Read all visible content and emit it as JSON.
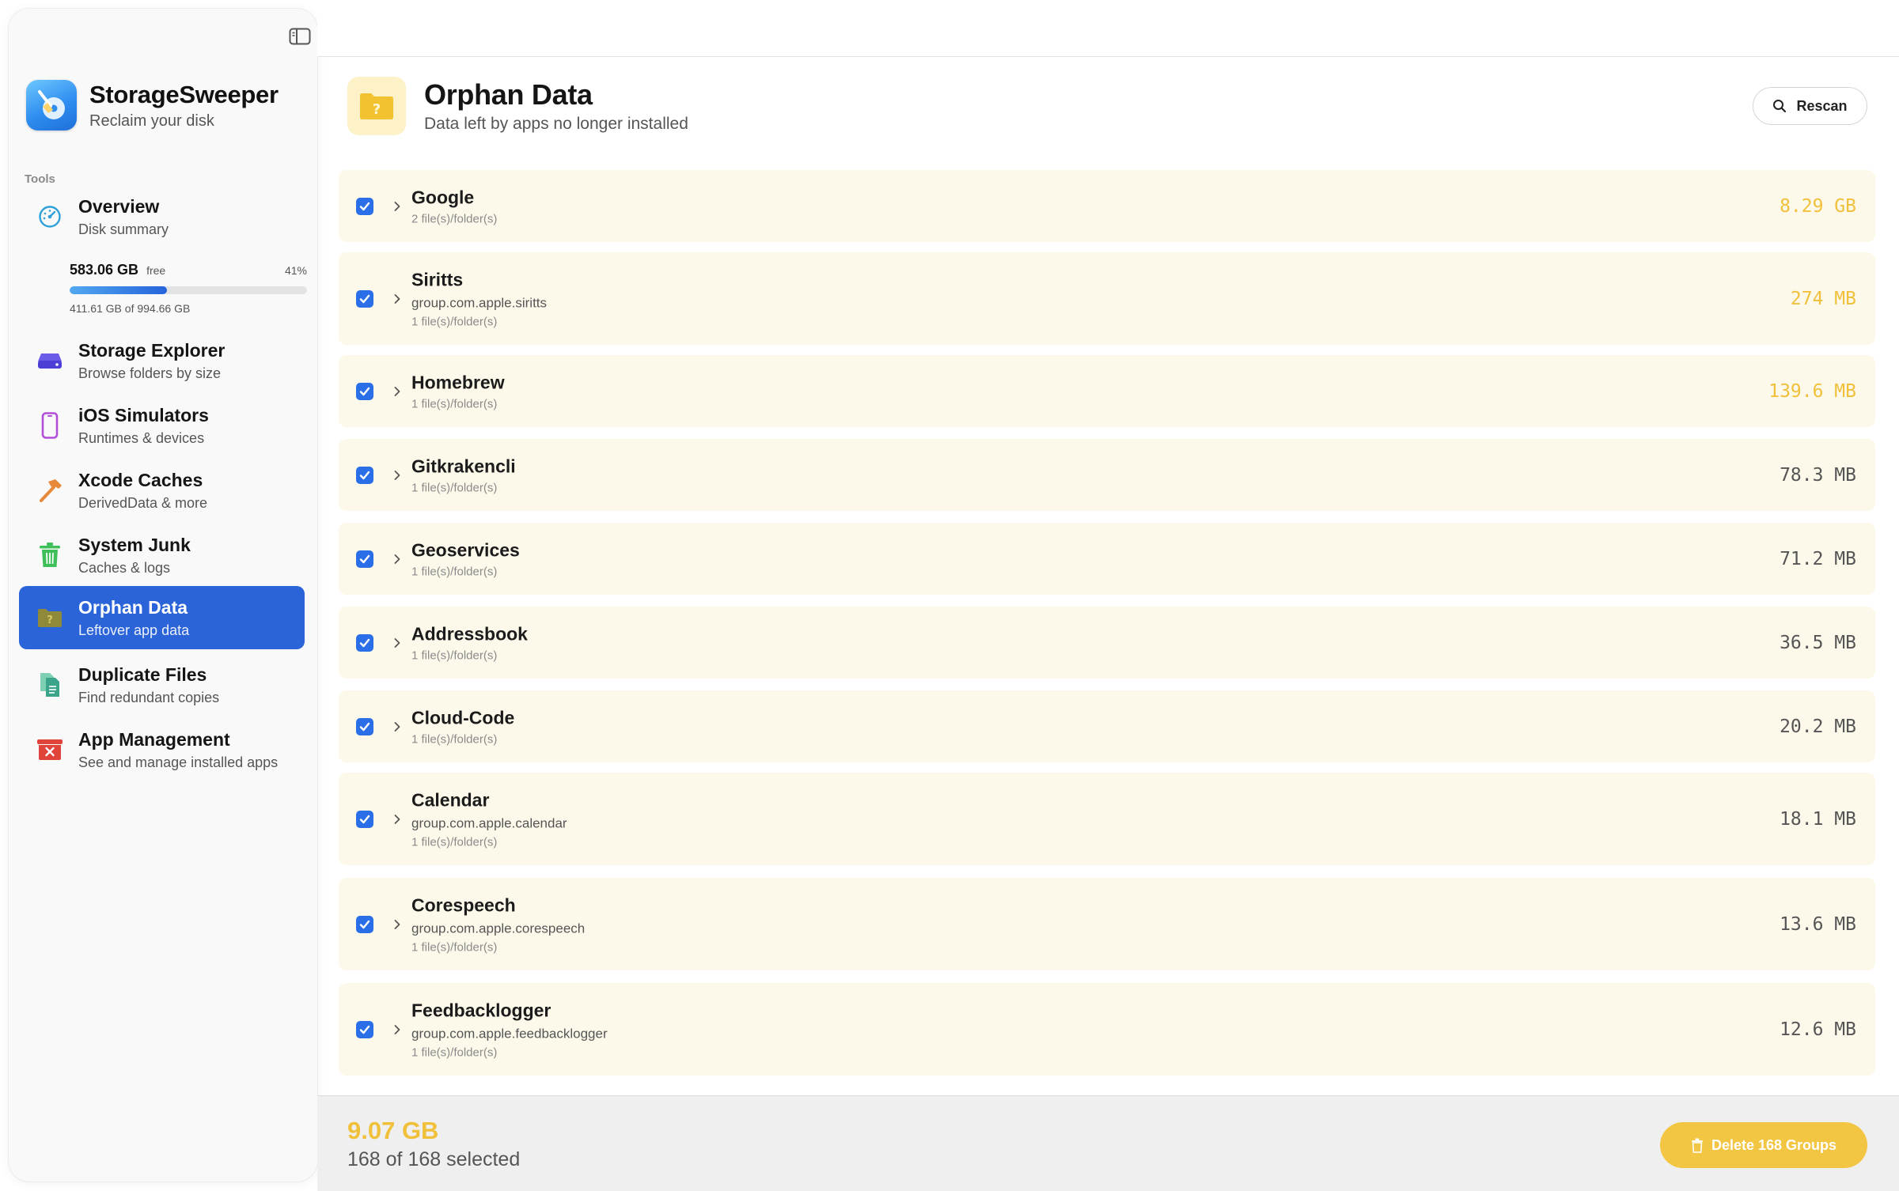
{
  "sidebar": {
    "app_title": "StorageSweeper",
    "app_subtitle": "Reclaim your disk",
    "section_label": "Tools",
    "disk": {
      "free": "583.06 GB",
      "free_label": "free",
      "percent_text": "41%",
      "used_fraction": 0.41,
      "used_text": "411.61 GB of 994.66 GB"
    },
    "items": [
      {
        "title": "Overview",
        "subtitle": "Disk summary",
        "icon": "gauge-icon"
      },
      {
        "title": "Storage Explorer",
        "subtitle": "Browse folders by size",
        "icon": "disk-drive-icon"
      },
      {
        "title": "iOS Simulators",
        "subtitle": "Runtimes & devices",
        "icon": "iphone-icon"
      },
      {
        "title": "Xcode Caches",
        "subtitle": "DerivedData & more",
        "icon": "hammer-icon"
      },
      {
        "title": "System Junk",
        "subtitle": "Caches & logs",
        "icon": "trash-icon"
      },
      {
        "title": "Orphan Data",
        "subtitle": "Leftover app data",
        "icon": "question-folder-icon",
        "active": true
      },
      {
        "title": "Duplicate Files",
        "subtitle": "Find redundant copies",
        "icon": "documents-icon"
      },
      {
        "title": "App Management",
        "subtitle": "See and manage installed apps",
        "icon": "app-remove-icon"
      }
    ]
  },
  "header": {
    "title": "Orphan Data",
    "subtitle": "Data left by apps no longer installed",
    "rescan_label": "Rescan"
  },
  "rows": [
    {
      "name": "Google",
      "id": "",
      "count": "2 file(s)/folder(s)",
      "size": "8.29 GB",
      "highlight": true,
      "checked": true
    },
    {
      "name": "Siritts",
      "id": "group.com.apple.siritts",
      "count": "1 file(s)/folder(s)",
      "size": "274 MB",
      "highlight": true,
      "checked": true
    },
    {
      "name": "Homebrew",
      "id": "",
      "count": "1 file(s)/folder(s)",
      "size": "139.6 MB",
      "highlight": true,
      "checked": true
    },
    {
      "name": "Gitkrakencli",
      "id": "",
      "count": "1 file(s)/folder(s)",
      "size": "78.3 MB",
      "highlight": false,
      "checked": true
    },
    {
      "name": "Geoservices",
      "id": "",
      "count": "1 file(s)/folder(s)",
      "size": "71.2 MB",
      "highlight": false,
      "checked": true
    },
    {
      "name": "Addressbook",
      "id": "",
      "count": "1 file(s)/folder(s)",
      "size": "36.5 MB",
      "highlight": false,
      "checked": true
    },
    {
      "name": "Cloud-Code",
      "id": "",
      "count": "1 file(s)/folder(s)",
      "size": "20.2 MB",
      "highlight": false,
      "checked": true
    },
    {
      "name": "Calendar",
      "id": "group.com.apple.calendar",
      "count": "1 file(s)/folder(s)",
      "size": "18.1 MB",
      "highlight": false,
      "checked": true
    },
    {
      "name": "Corespeech",
      "id": "group.com.apple.corespeech",
      "count": "1 file(s)/folder(s)",
      "size": "13.6 MB",
      "highlight": false,
      "checked": true
    },
    {
      "name": "Feedbacklogger",
      "id": "group.com.apple.feedbacklogger",
      "count": "1 file(s)/folder(s)",
      "size": "12.6 MB",
      "highlight": false,
      "checked": true
    }
  ],
  "footer": {
    "total": "9.07 GB",
    "selected": "168 of 168 selected",
    "delete_label": "Delete 168 Groups"
  },
  "colors": {
    "accent": "#2b63d9",
    "checkbox": "#2b6fe8",
    "warning": "#f0c03a",
    "row_bg": "#fdf9ea"
  }
}
